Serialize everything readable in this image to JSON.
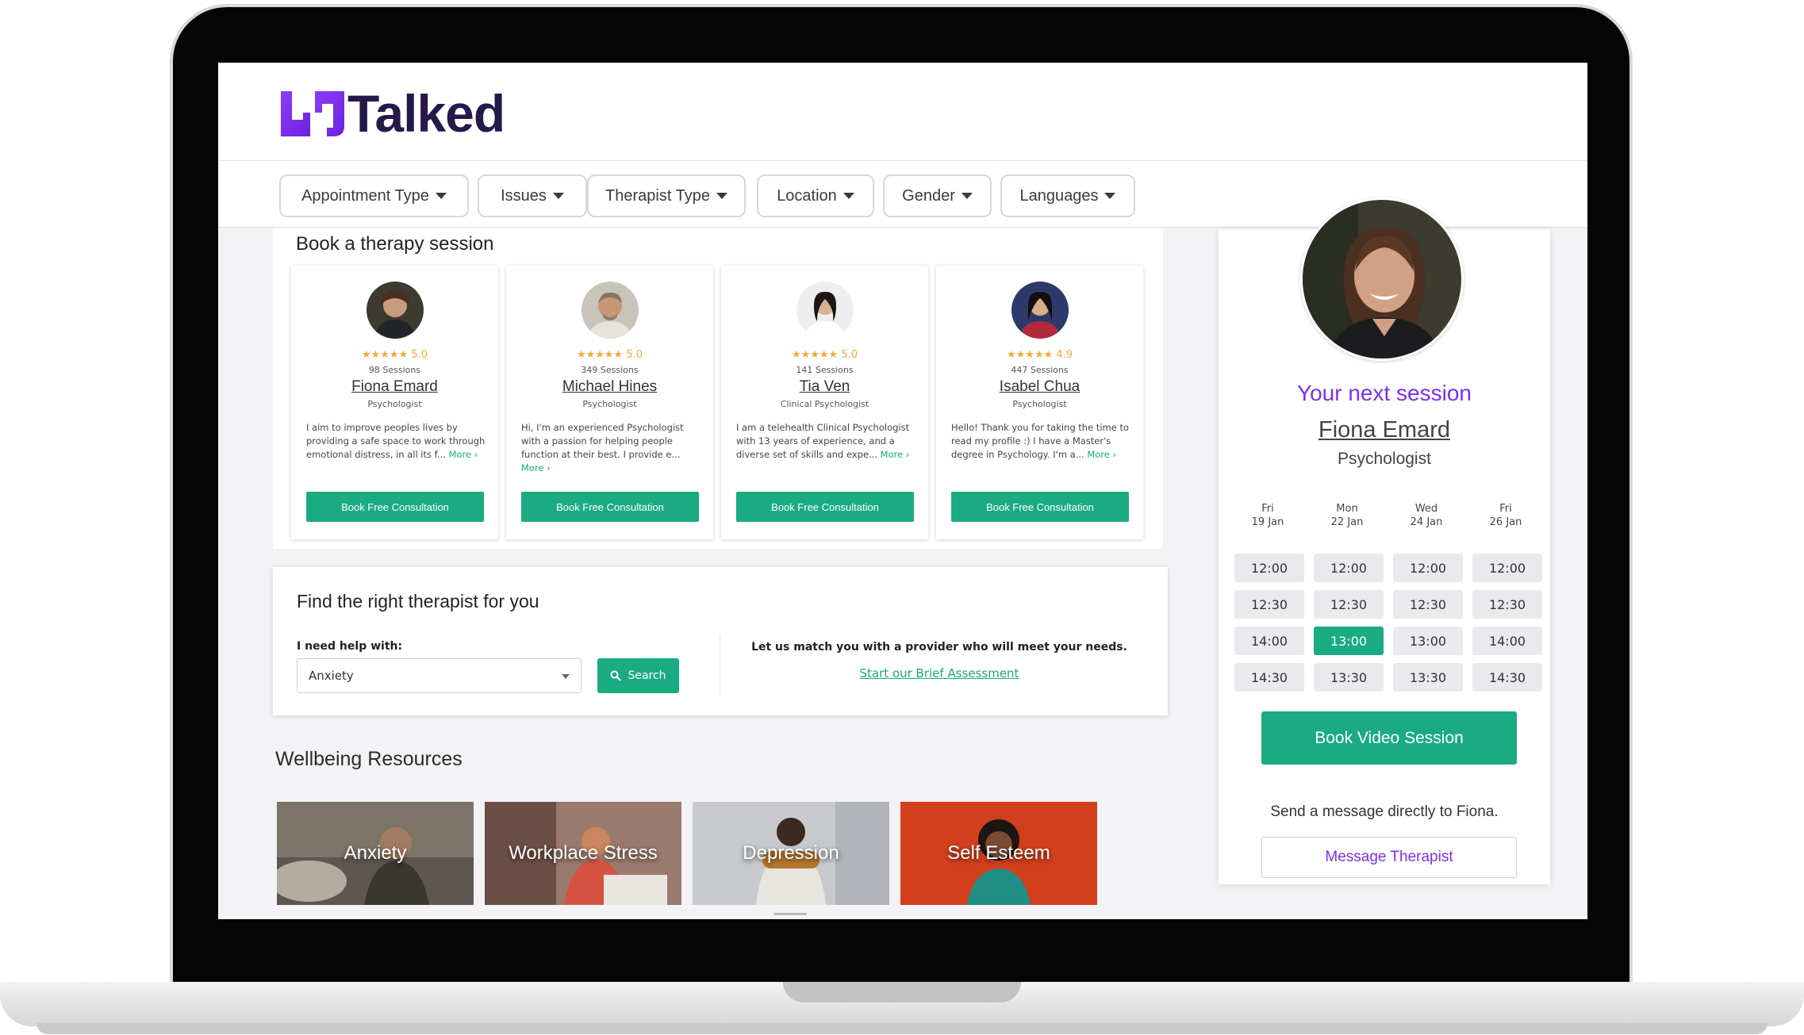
{
  "app": {
    "name": "Talked"
  },
  "filters": [
    "Appointment Type",
    "Issues",
    "Therapist Type",
    "Location",
    "Gender",
    "Languages"
  ],
  "book_section": {
    "title": "Book a therapy session",
    "therapists": [
      {
        "rating": "5.0",
        "sessions": "98 Sessions",
        "name": "Fiona Emard",
        "role": "Psychologist",
        "bio": "I aim to improve peoples lives by providing a safe space to work through emotional distress, in all its f...",
        "more": "More",
        "button": "Book Free Consultation"
      },
      {
        "rating": "5.0",
        "sessions": "349 Sessions",
        "name": "Michael Hines",
        "role": "Psychologist",
        "bio": "Hi, I'm an experienced Psychologist with a passion for helping people function at their best. I provide e...",
        "more": "More",
        "button": "Book Free Consultation"
      },
      {
        "rating": "5.0",
        "sessions": "141 Sessions",
        "name": "Tia Ven",
        "role": "Clinical Psychologist",
        "bio": "I am a telehealth Clinical Psychologist with 13 years of experience, and a diverse set of skills and expe...",
        "more": "More",
        "button": "Book Free Consultation"
      },
      {
        "rating": "4.9",
        "sessions": "447 Sessions",
        "name": "Isabel Chua",
        "role": "Psychologist",
        "bio": "Hello! Thank you for taking the time to read my profile :) I have a Master's degree in Psychology. I'm a...",
        "more": "More",
        "button": "Book Free Consultation"
      }
    ]
  },
  "finder": {
    "title": "Find the right therapist for you",
    "help_label": "I need help with:",
    "selected_issue": "Anxiety",
    "search_label": "Search",
    "match_text": "Let us match you with a provider who will meet your needs.",
    "assessment_link": "Start our Brief Assessment"
  },
  "resources": {
    "title": "Wellbeing Resources",
    "tiles": [
      "Anxiety",
      "Workplace Stress",
      "Depression",
      "Self Esteem"
    ]
  },
  "next_session": {
    "label": "Your next session",
    "name": "Fiona Emard",
    "role": "Psychologist",
    "days": [
      {
        "day": "Fri",
        "date": "19 Jan",
        "slots": [
          "12:00",
          "12:30",
          "14:00",
          "14:30"
        ]
      },
      {
        "day": "Mon",
        "date": "22 Jan",
        "slots": [
          "12:00",
          "12:30",
          "13:00",
          "13:30"
        ]
      },
      {
        "day": "Wed",
        "date": "24 Jan",
        "slots": [
          "12:00",
          "12:30",
          "13:00",
          "13:30"
        ]
      },
      {
        "day": "Fri",
        "date": "26 Jan",
        "slots": [
          "12:00",
          "12:30",
          "14:00",
          "14:30"
        ]
      }
    ],
    "selected_slot": {
      "day_index": 1,
      "time": "13:00"
    },
    "book_button": "Book Video Session",
    "message_prompt": "Send a message directly to Fiona.",
    "message_button": "Message Therapist"
  },
  "colors": {
    "brand_purple": "#7b2ff2",
    "brand_dark": "#26194a",
    "accent_green": "#1aab82",
    "star": "#f2a93b"
  },
  "icons": [
    "talked-logo-icon",
    "caret-down-icon",
    "star-icon",
    "search-icon",
    "chevron-right-icon"
  ]
}
